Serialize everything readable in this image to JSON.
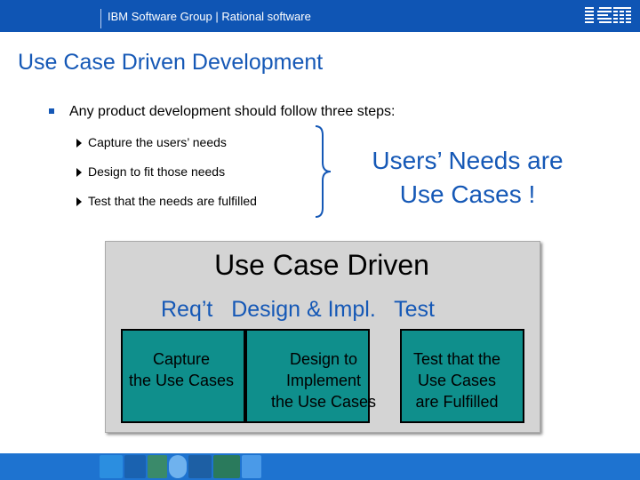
{
  "header": {
    "text": "IBM Software Group  |  Rational software",
    "logo_text": "IBM",
    "color": "#0f55b4"
  },
  "slide": {
    "title": "Use Case Driven Development",
    "bullet": "Any product development should follow three steps:",
    "steps": [
      "Capture the users’ needs",
      "Design to fit those needs",
      "Test that the needs are fulfilled"
    ],
    "callout_line1": "Users’ Needs are",
    "callout_line2": "Use Cases !",
    "accent_color": "#1558b6"
  },
  "diagram": {
    "title": "Use Case Driven",
    "subtitle": "Req’t   Design & Impl.   Test",
    "boxes": [
      {
        "lines": [
          "Capture",
          "the Use Cases"
        ]
      },
      {
        "lines": [
          "Design to",
          "Implement",
          "the Use Cases"
        ]
      },
      {
        "lines": [
          "Test that the",
          "Use Cases",
          "are Fulfilled"
        ]
      }
    ],
    "box_color": "#0f8f8c"
  },
  "footer": {
    "icons": [
      "people-icon",
      "grid-icon",
      "globe-icon",
      "cd-icon",
      "molecule-icon",
      "figures-icon",
      "cross-icon"
    ],
    "color": "#1e73d0"
  }
}
